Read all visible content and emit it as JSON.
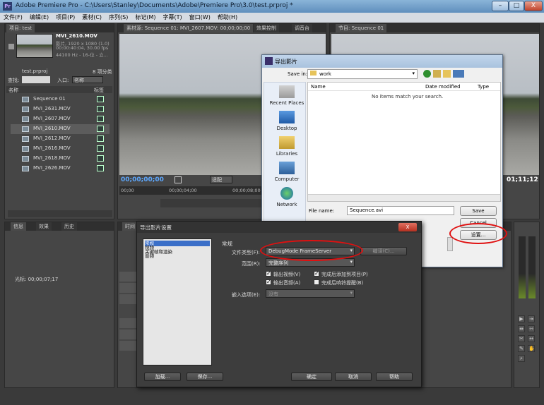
{
  "window": {
    "title": "Adobe Premiere Pro - C:\\Users\\Stanley\\Documents\\Adobe\\Premiere Pro\\3.0\\test.prproj *",
    "min": "–",
    "max": "□",
    "close": "X"
  },
  "menu": [
    "文件(F)",
    "编辑(E)",
    "项目(P)",
    "素材(C)",
    "序列(S)",
    "标记(M)",
    "字幕(T)",
    "窗口(W)",
    "帮助(H)"
  ],
  "project": {
    "tab": "项目: test",
    "clip_name": "MVI_2610.MOV",
    "clip_info1": "影片, 1920 x 1080 (1.0)",
    "clip_info2": "00:00:40:04, 30.00 fps",
    "clip_info3": "44100 Hz - 16-位 - 立...",
    "project_file": "test.prproj",
    "item_count": "8 项分类",
    "search_label": "查找:",
    "in_label": "入口:",
    "in_value": "名称",
    "col_name": "名称",
    "col_label": "标签",
    "items": [
      "Sequence 01",
      "MVI_2631.MOV",
      "MVI_2607.MOV",
      "MVI_2610.MOV",
      "MVI_2612.MOV",
      "MVI_2616.MOV",
      "MVI_2618.MOV",
      "MVI_2626.MOV"
    ]
  },
  "source_monitor": {
    "tab": "素材源: Sequence 01: MVI_2607.MOV: 00;00;00;00",
    "tab2": "效果控制",
    "tab3": "调音台",
    "timecode": "00;00;00;00",
    "fit": "适配",
    "ruler_left": "00;00",
    "ruler_mid": "00;00;04;00",
    "ruler_right": "00;00;08;00"
  },
  "program_monitor": {
    "tab": "节目: Sequence 01",
    "timecode": "01;11;12"
  },
  "info_panel": {
    "tabs": [
      "信息",
      "效果",
      "历史"
    ],
    "cursor_label": "光标: 00;00;07;17"
  },
  "timeline": {
    "tab": "时间"
  },
  "save_dialog": {
    "title": "导出影片",
    "save_in_label": "Save in:",
    "save_in_value": "work",
    "places": [
      "Recent Places",
      "Desktop",
      "Libraries",
      "Computer",
      "Network"
    ],
    "col_name": "Name",
    "col_date": "Date modified",
    "col_type": "Type",
    "empty_msg": "No items match your search.",
    "filename_label": "File name:",
    "filename_value": "Sequence.avi",
    "save_btn": "Save",
    "cancel_btn": "Cancel",
    "settings_btn": "设置..."
  },
  "settings_dialog": {
    "title": "导出影片设置",
    "categories": [
      "常规",
      "视频",
      "关键帧和渲染",
      "音频"
    ],
    "section": "常规",
    "filetype_label": "文件类型(F):",
    "filetype_value": "DebugMode FrameServer",
    "compile_btn": "编译(C)...",
    "range_label": "范围(R):",
    "range_value": "完整序列",
    "export_video": "输出视频(V)",
    "export_audio": "输出音频(A)",
    "add_to_project": "完成后添加到项目(P)",
    "beep": "完成后响铃提醒(B)",
    "embed_label": "嵌入选项(E):",
    "embed_value": "没有",
    "load_btn": "加载...",
    "save_btn": "保存...",
    "ok_btn": "确定",
    "cancel_btn": "取消",
    "help_btn": "帮助",
    "close_btn": "X"
  },
  "annotation_color": "#e01010"
}
